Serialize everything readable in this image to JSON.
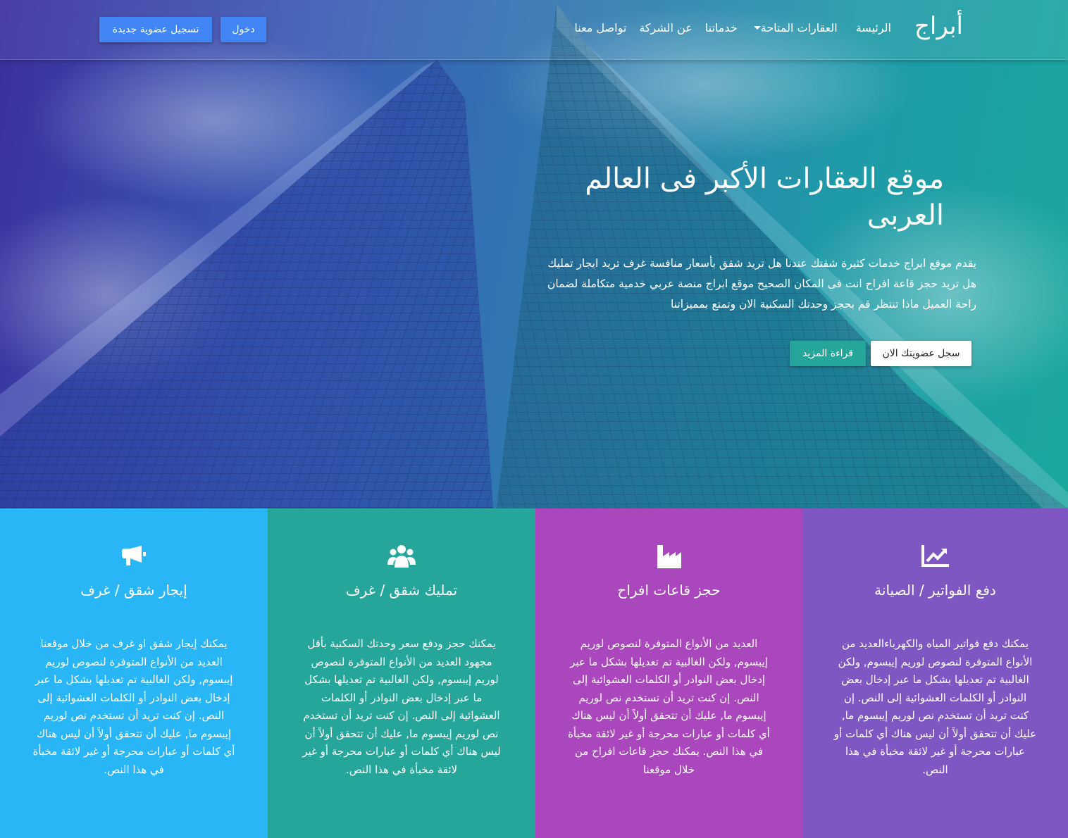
{
  "brand": "أبراج",
  "nav": {
    "items": [
      "الرئيسة",
      "العقارات المتاحة",
      "خدماتنا",
      "عن الشركة",
      "تواصل معنا"
    ]
  },
  "auth": {
    "login": "دخول",
    "register": "تسجيل عضوية جديدة"
  },
  "hero": {
    "title": "موقع العقارات الأكبر فى العالم العربى",
    "text": "يقدم موقع ابراج خدمات كثيرة شقتك عندنا هل تريد شقق بأسعار منافسة غرف تريد ايجار تمليك هل تريد حجز قاعة افراح انت فى المكان الصحيح موقع ابراج منصة عربي خدمية متكاملة لضمان راحة العميل ماذا تنتظر قم بحجز وحدتك السكنية الان وتمتع بمميزاتنا",
    "register_btn": "سجل عضويتك الان",
    "more_btn": "قراءة المزيد"
  },
  "features": [
    {
      "icon": "chart-line-icon",
      "title": "دفع الفواتير / الصيانة",
      "text": "يمكنك دفع فواتير المياه والكهرباءالعديد من الأنواع المتوفرة لنصوص لوريم إيبسوم, ولكن الغالبية تم تعديلها بشكل ما عبر إدخال بعض النوادر أو الكلمات العشوائية إلى النص. إن كنت تريد أن تستخدم نص لوريم إيبسوم ما, عليك أن تتحقق أولاً أن ليس هناك أي كلمات أو عبارات محرجة أو غير لائقة مخبأة في هذا النص.",
      "color": "#7e57c2"
    },
    {
      "icon": "industry-icon",
      "title": "حجز قاعات افراح",
      "text": "العديد من الأنواع المتوفرة لنصوص لوريم إيبسوم, ولكن الغالبية تم تعديلها بشكل ما عبر إدخال بعض النوادر أو الكلمات العشوائية إلى النص. إن كنت تريد أن تستخدم نص لوريم إيبسوم ما, عليك أن تتحقق أولاً أن ليس هناك أي كلمات أو عبارات محرجة أو غير لائقة مخبأة في هذا النص. يمكنك حجز قاعات افراح من خلال موقعنا",
      "color": "#ab47bc"
    },
    {
      "icon": "users-icon",
      "title": "تمليك شقق / غرف",
      "text": "يمكنك حجز ودفع سعر وحدتك السكنية بأقل مجهود العديد من الأنواع المتوفرة لنصوص لوريم إيبسوم, ولكن الغالبية تم تعديلها بشكل ما عبر إدخال بعض النوادر أو الكلمات العشوائية إلى النص. إن كنت تريد أن تستخدم نص لوريم إيبسوم ما, عليك أن تتحقق أولاً أن ليس هناك أي كلمات أو عبارات محرجة أو غير لائقة مخبأة في هذا النص.",
      "color": "#26a69a"
    },
    {
      "icon": "megaphone-icon",
      "title": "إيجار شقق / غرف",
      "text": "يمكنك إيجار شقق او غرف من خلال موقعنا العديد من الأنواع المتوفرة لنصوص لوريم إيبسوم, ولكن الغالبية تم تعديلها بشكل ما عبر إدخال بعض النوادر أو الكلمات العشوائية إلى النص. إن كنت تريد أن تستخدم نص لوريم إيبسوم ما, عليك أن تتحقق أولاً أن ليس هناك أي كلمات أو عبارات محرجة أو غير لائقة مخبأة في هذا النص.",
      "color": "#29b6f6"
    }
  ],
  "colors": {
    "primary_button": "#4285f4",
    "hero_button_teal": "#26a69a",
    "hero_button_white": "#ffffff"
  }
}
